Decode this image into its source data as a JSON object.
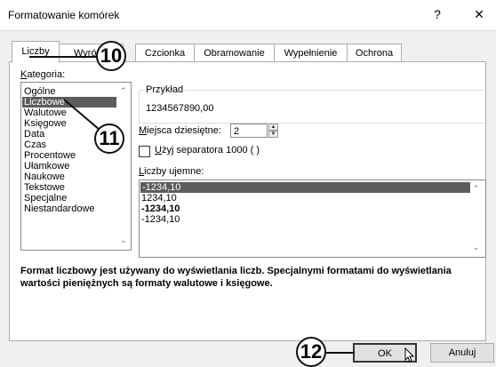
{
  "window": {
    "title": "Formatowanie komórek",
    "help_glyph": "?",
    "close_glyph": "✕"
  },
  "tabs": [
    {
      "label": "Liczby",
      "active": true
    },
    {
      "label": "Wyró",
      "active": false
    },
    {
      "label": "Czcionka",
      "active": false
    },
    {
      "label": "Obramowanie",
      "active": false
    },
    {
      "label": "Wypełnienie",
      "active": false
    },
    {
      "label": "Ochrona",
      "active": false
    }
  ],
  "category": {
    "label_accel": "K",
    "label_rest": "ategoria:",
    "items": [
      "Ogólne",
      "Liczbowe",
      "Walutowe",
      "Księgowe",
      "Data",
      "Czas",
      "Procentowe",
      "Ułamkowe",
      "Naukowe",
      "Tekstowe",
      "Specjalne",
      "Niestandardowe"
    ],
    "selected": "Liczbowe"
  },
  "sample": {
    "label": "Przykład",
    "value": "1234567890,00"
  },
  "decimals": {
    "label_accel": "M",
    "label_rest": "iejsca dziesiętne:",
    "value": "2"
  },
  "separator": {
    "label_accel": "U",
    "label_rest": "żyj separatora 1000 ( )",
    "checked": false
  },
  "negative": {
    "label_accel": "L",
    "label_rest": "iczby ujemne:",
    "items": [
      "-1234,10",
      "1234,10",
      "-1234,10",
      "-1234,10"
    ],
    "selected_index": 0
  },
  "description": "Format liczbowy jest używany do wyświetlania liczb. Specjalnymi formatami do wyświetlania wartości pieniężnych są formaty walutowe i księgowe.",
  "buttons": {
    "ok": "OK",
    "cancel": "Anuluj"
  },
  "callouts": {
    "tab": "10",
    "category": "11",
    "ok": "12"
  },
  "colors": {
    "selection": "#5c5c5c",
    "panel": "#ffffff",
    "dialog": "#f0f0f0"
  }
}
